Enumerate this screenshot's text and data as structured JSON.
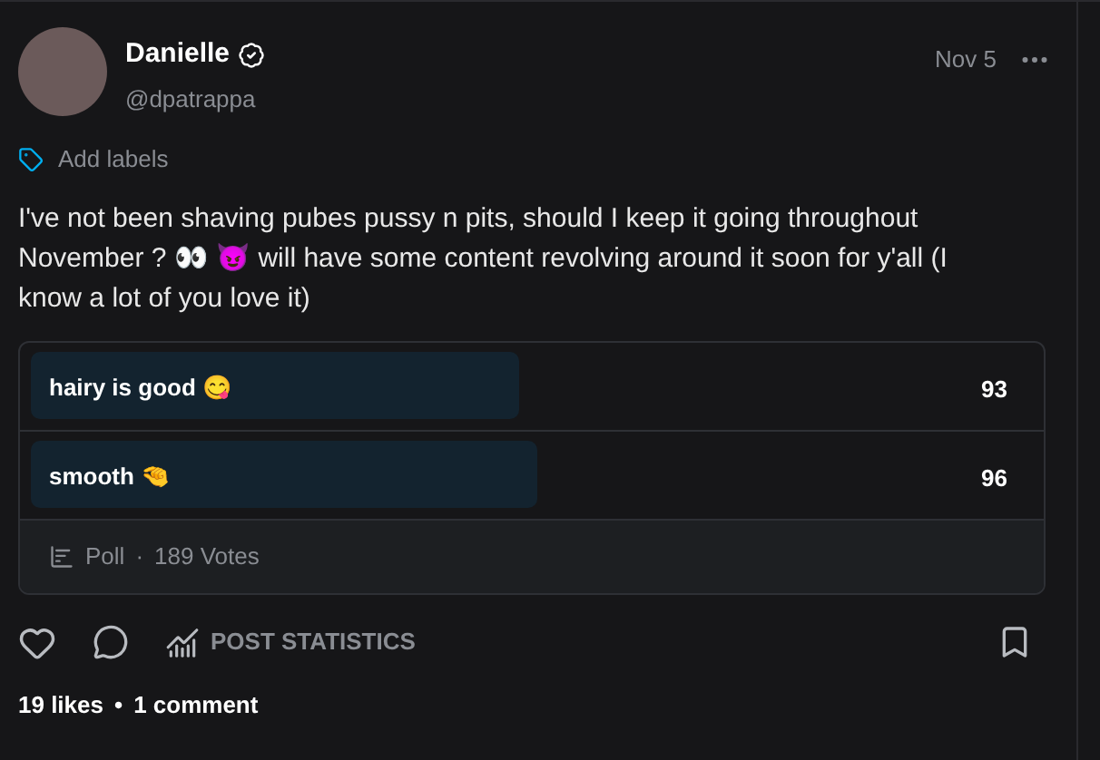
{
  "author": {
    "name": "Danielle",
    "verified": true,
    "handle": "@dpatrappa"
  },
  "date": "Nov 5",
  "add_labels": "Add labels",
  "text": "I've not been shaving pubes pussy n pits, should I keep it going throughout November ? 👀 😈 will have some content revolving around it soon for y'all (I know a lot of you love it)",
  "poll": {
    "options": [
      {
        "label": "hairy is good 😋",
        "count": "93",
        "level": 0.49
      },
      {
        "label": "smooth 🤏",
        "count": "96",
        "level": 0.51
      }
    ],
    "type": "Poll",
    "separator": "·",
    "votes": "189 Votes"
  },
  "actions": {
    "post_statistics": "POST STATISTICS"
  },
  "stats": {
    "likes": "19 likes",
    "separator": "•",
    "comments": "1 comment"
  }
}
